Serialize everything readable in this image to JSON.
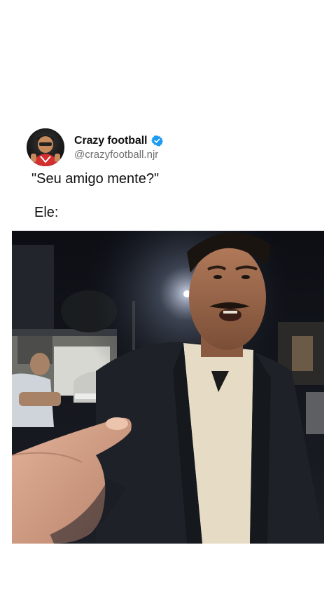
{
  "post": {
    "author": {
      "display_name": "Crazy football",
      "handle": "@crazyfootball.njr",
      "verified": true,
      "avatar_icon": "profile-avatar"
    },
    "text_line1": "\"Seu amigo mente?\"",
    "text_line2": "Ele:",
    "media": {
      "type": "video-frame",
      "icon": "video-thumbnail"
    }
  },
  "colors": {
    "background": "#ffffff",
    "verified_badge": "#1d9bf0",
    "handle_text": "#6f6f6f",
    "primary_text": "#111111"
  }
}
